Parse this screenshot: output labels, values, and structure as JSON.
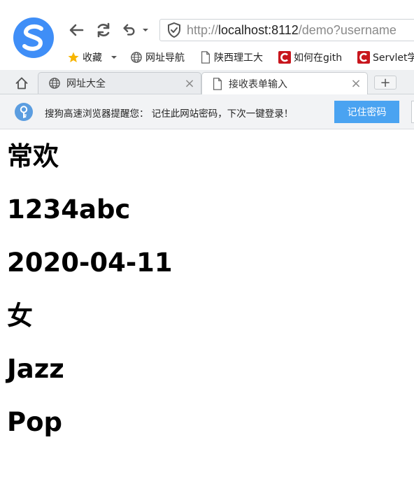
{
  "browser": {
    "url": {
      "scheme": "http://",
      "host": "localhost:8112",
      "path": "/demo?username"
    },
    "bookmarks": [
      {
        "label": "收藏",
        "icon": "star-icon"
      },
      {
        "label": "网址导航",
        "icon": "globe-icon"
      },
      {
        "label": "陕西理工大",
        "icon": "page-icon"
      },
      {
        "label": "如何在gith",
        "icon": "csdn-icon"
      },
      {
        "label": "Servlet学",
        "icon": "csdn-icon"
      }
    ],
    "tabs": [
      {
        "title": "网址大全",
        "icon": "globe-icon",
        "close": "×"
      },
      {
        "title": "接收表单输入",
        "icon": "page-icon",
        "close": "×"
      }
    ],
    "new_tab": "+",
    "notification": {
      "message": "搜狗高速浏览器提醒您： 记住此网站密码，下次一键登录！",
      "button": "记住密码"
    }
  },
  "page": {
    "lines": [
      "常欢",
      "1234abc",
      "2020-04-11",
      "女",
      "Jazz",
      "Pop"
    ]
  },
  "colors": {
    "accent": "#4aa3f1",
    "logo": "#3f8ef7",
    "csdn": "#c8161d",
    "star": "#f7b500"
  }
}
